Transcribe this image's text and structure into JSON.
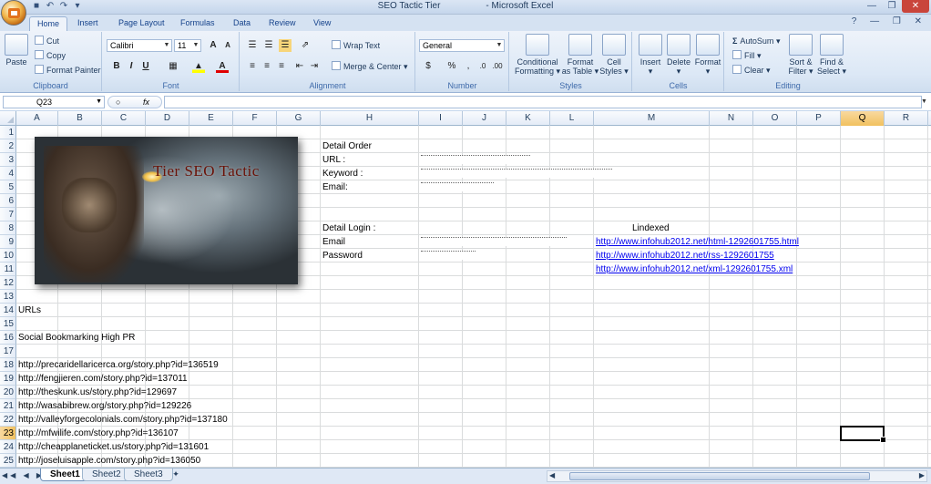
{
  "window": {
    "title": "SEO Tactic Tier",
    "app_name": "- Microsoft Excel"
  },
  "ribbon_tabs": [
    "Home",
    "Insert",
    "Page Layout",
    "Formulas",
    "Data",
    "Review",
    "View"
  ],
  "ribbon": {
    "clipboard": {
      "paste": "Paste",
      "cut": "Cut",
      "copy": "Copy",
      "format_painter": "Format Painter",
      "label": "Clipboard"
    },
    "font": {
      "name": "Calibri",
      "size": "11",
      "label": "Font"
    },
    "alignment": {
      "wrap_text": "Wrap Text",
      "merge_center": "Merge & Center",
      "label": "Alignment"
    },
    "number": {
      "format": "General",
      "label": "Number"
    },
    "styles": {
      "conditional_1": "Conditional",
      "conditional_2": "Formatting",
      "format_table_1": "Format",
      "format_table_2": "as Table",
      "cell_styles_1": "Cell",
      "cell_styles_2": "Styles",
      "label": "Styles"
    },
    "cells": {
      "insert": "Insert",
      "delete": "Delete",
      "format": "Format",
      "label": "Cells"
    },
    "editing": {
      "autosum": "AutoSum",
      "fill": "Fill",
      "clear": "Clear",
      "sort_1": "Sort &",
      "sort_2": "Filter",
      "find_1": "Find &",
      "find_2": "Select",
      "label": "Editing"
    }
  },
  "formula_bar": {
    "name_box": "Q23",
    "fx": "fx",
    "value": ""
  },
  "columns": [
    "A",
    "B",
    "C",
    "D",
    "E",
    "F",
    "G",
    "H",
    "I",
    "J",
    "K",
    "L",
    "M",
    "N",
    "O",
    "P",
    "Q",
    "R"
  ],
  "selected_column": "Q",
  "rows": [
    "1",
    "2",
    "3",
    "4",
    "5",
    "6",
    "7",
    "8",
    "9",
    "10",
    "11",
    "12",
    "13",
    "14",
    "15",
    "16",
    "17",
    "18",
    "19",
    "20",
    "21",
    "22",
    "23",
    "24",
    "25"
  ],
  "selected_row": "23",
  "picture": {
    "title": "Tier SEO Tactic"
  },
  "cells": {
    "H2": "Detail Order",
    "H3": "URL :",
    "H4": "Keyword :",
    "H5": "Email:",
    "H8": "Detail Login :",
    "H9": "Email",
    "H10": "Password",
    "M8": "Lindexed",
    "M9": "http://www.infohub2012.net/html-1292601755.html",
    "M10": "http://www.infohub2012.net/rss-1292601755",
    "M11": "http://www.infohub2012.net/xml-1292601755.xml",
    "A14": "URLs",
    "A16": "Social Bookmarking High PR",
    "A18": "http://precaridellaricerca.org/story.php?id=136519",
    "A19": "http://fengjieren.com/story.php?id=137011",
    "A20": "http://theskunk.us/story.php?id=129697",
    "A21": "http://wasabibrew.org/story.php?id=129226",
    "A22": "http://valleyforgecolonials.com/story.php?id=137180",
    "A23": "http://mfwilife.com/story.php?id=136107",
    "A24": "http://cheapplaneticket.us/story.php?id=131601",
    "A25": "http://joseluisapple.com/story.php?id=136050"
  },
  "sheets": [
    "Sheet1",
    "Sheet2",
    "Sheet3"
  ],
  "active_sheet": "Sheet1"
}
